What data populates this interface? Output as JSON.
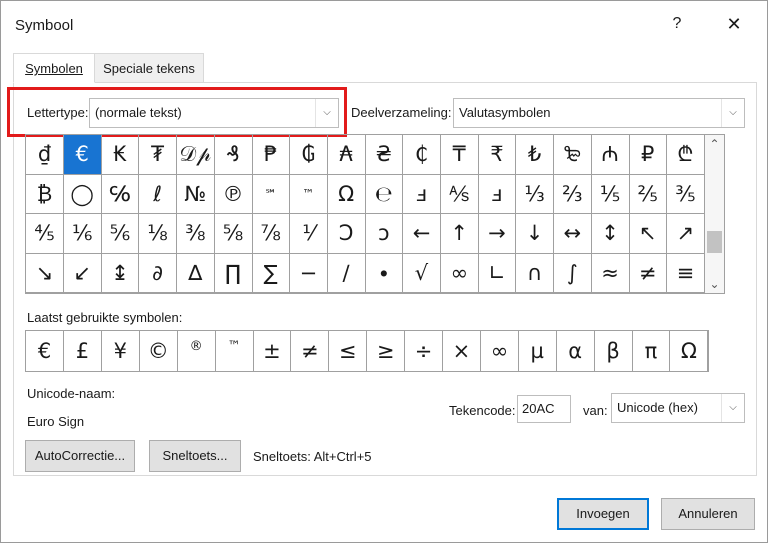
{
  "window": {
    "title": "Symbool",
    "help_glyph": "?",
    "close_glyph": "✕"
  },
  "tabs": [
    {
      "label": "Symbolen",
      "active": true
    },
    {
      "label": "Speciale tekens",
      "active": false
    }
  ],
  "font": {
    "label": "Lettertype:",
    "value": "(normale tekst)"
  },
  "subset": {
    "label": "Deelverzameling:",
    "value": "Valutasymbolen"
  },
  "symbols": [
    [
      "₫",
      "€",
      "₭",
      "₮",
      "𝒟𝓅",
      "₰",
      "₱",
      "₲",
      "₳",
      "₴",
      "₵",
      "₸",
      "₹",
      "₺",
      "₻",
      "₼",
      "₽",
      "₾"
    ],
    [
      "₿",
      "◯",
      "℅",
      "ℓ",
      "№",
      "℗",
      "℠",
      "™",
      "Ω",
      "℮",
      "ⅎ",
      "⅍",
      "ⅎ",
      "⅓",
      "⅔",
      "⅕",
      "⅖",
      "⅗"
    ],
    [
      "⅘",
      "⅙",
      "⅚",
      "⅛",
      "⅜",
      "⅝",
      "⅞",
      "⅟",
      "Ↄ",
      "ↄ",
      "←",
      "↑",
      "→",
      "↓",
      "↔",
      "↕",
      "↖",
      "↗"
    ],
    [
      "↘",
      "↙",
      "↨",
      "∂",
      "∆",
      "∏",
      "∑",
      "−",
      "∕",
      "∙",
      "√",
      "∞",
      "∟",
      "∩",
      "∫",
      "≈",
      "≠",
      "≡"
    ]
  ],
  "selected_symbol": "€",
  "recent": {
    "label": "Laatst gebruikte symbolen:",
    "items": [
      "€",
      "£",
      "¥",
      "©",
      "®",
      "™",
      "±",
      "≠",
      "≤",
      "≥",
      "÷",
      "×",
      "∞",
      "µ",
      "α",
      "β",
      "π",
      "Ω"
    ]
  },
  "unicode": {
    "label": "Unicode-naam:",
    "name": "Euro Sign"
  },
  "charcode": {
    "label": "Tekencode:",
    "value": "20AC",
    "from_label": "van:",
    "from_value": "Unicode (hex)"
  },
  "buttons": {
    "autocorrect": "AutoCorrectie...",
    "shortcut": "Sneltoets...",
    "shortcut_info": "Sneltoets: Alt+Ctrl+5",
    "insert": "Invoegen",
    "cancel": "Annuleren"
  },
  "colors": {
    "highlight": "#e21b1b",
    "selection": "#1874d2",
    "default_button_border": "#0078d7"
  }
}
